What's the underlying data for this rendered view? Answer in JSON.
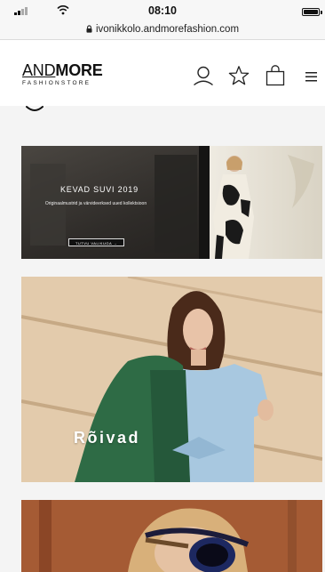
{
  "status_bar": {
    "time": "08:10",
    "icons": [
      "signal-icon",
      "wifi-icon",
      "battery-icon"
    ]
  },
  "browser": {
    "url": "ivonikkolo.andmorefashion.com",
    "icons": [
      "lock-icon"
    ]
  },
  "header": {
    "logo_and": "AND",
    "logo_more": "MORE",
    "logo_sub": "FASHIONSTORE",
    "icons": [
      "account-icon",
      "wishlist-star-icon",
      "shopping-bag-icon",
      "menu-icon"
    ]
  },
  "scroll_hint": {
    "icon": "chevron-down-icon"
  },
  "banner": {
    "title": "KEVAD SUVI 2019",
    "subtitle": "Originaalmustrid ja värvideerksed uued kollektsioon",
    "button_label": "TUTVU VALIKUGA →"
  },
  "categories": [
    {
      "label": "Rõivad"
    },
    {
      "label": ""
    }
  ],
  "colors": {
    "background": "#f4f4f4",
    "header_bg": "#ffffff",
    "text": "#111111"
  }
}
